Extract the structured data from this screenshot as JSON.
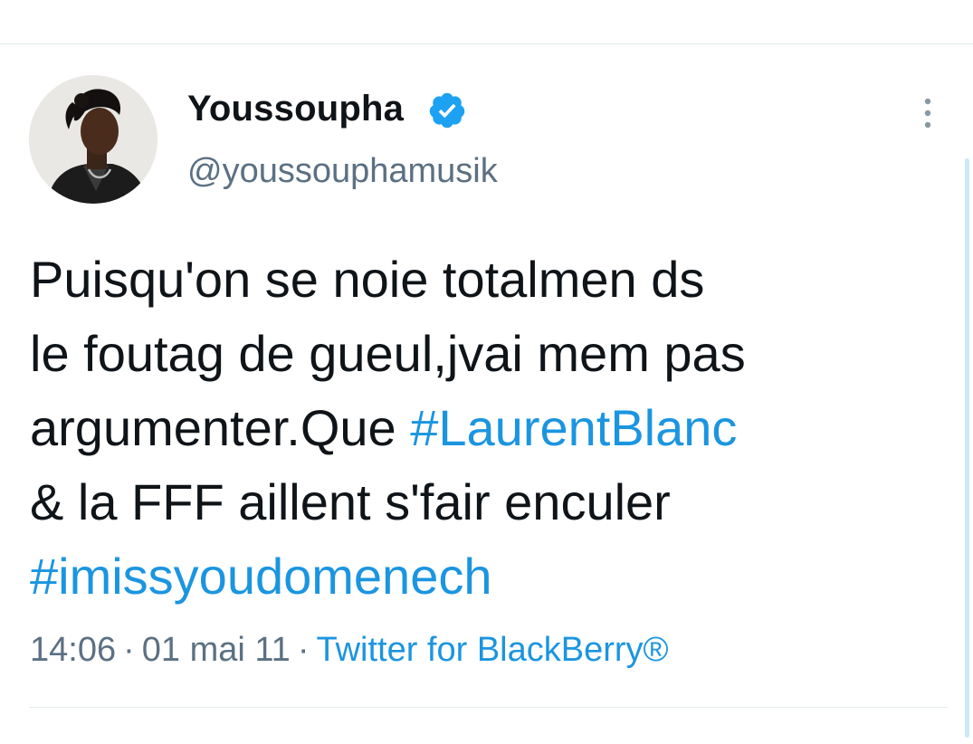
{
  "tweet": {
    "author": {
      "display_name": "Youssoupha",
      "handle": "@youssouphamusik",
      "verified": true
    },
    "text": {
      "line1": "Puisqu'on se noie totalmen ds",
      "line2": "le foutag de gueul,jvai mem pas",
      "line3_prefix": "argumenter.Que ",
      "hashtag1": "#LaurentBlanc",
      "line4": "& la FFF aillent s'fair enculer",
      "hashtag2": "#imissyoudomenech"
    },
    "meta": {
      "time": "14:06",
      "separator": "·",
      "date": "01 mai 11",
      "source": "Twitter for BlackBerry®"
    }
  },
  "icons": {
    "verified": "verified-badge-icon",
    "more": "more-vertical-icon"
  },
  "colors": {
    "link": "#1b95e0",
    "secondary_text": "#5b7083",
    "primary_text": "#0f1419",
    "divider": "#e6ecf0"
  }
}
